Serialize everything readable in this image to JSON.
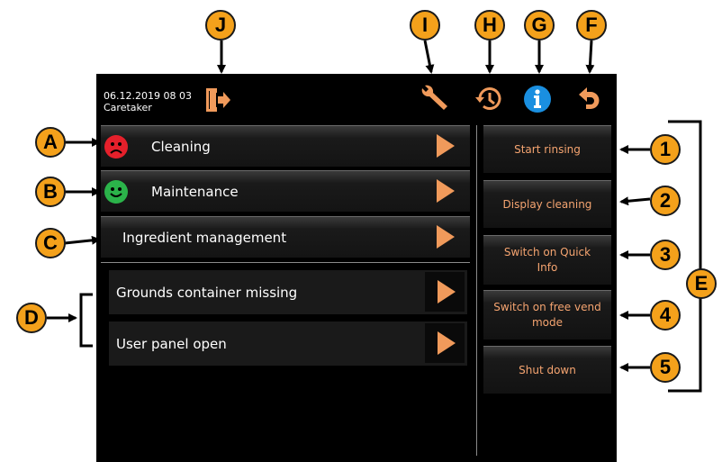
{
  "header": {
    "datetime": "06.12.2019 08 03",
    "user": "Caretaker"
  },
  "icons": {
    "exit": "exit-door-icon",
    "service": "wrench-icon",
    "history": "history-clock-icon",
    "info": "info-icon",
    "back": "back-arrow-icon"
  },
  "menu": {
    "items": [
      {
        "label": "Cleaning",
        "status": "sad-red"
      },
      {
        "label": "Maintenance",
        "status": "happy-green"
      },
      {
        "label": "Ingredient management"
      }
    ]
  },
  "messages": [
    {
      "label": "Grounds container missing"
    },
    {
      "label": "User panel open"
    }
  ],
  "actions": [
    {
      "label": "Start rinsing"
    },
    {
      "label": "Display cleaning"
    },
    {
      "label": "Switch on Quick Info"
    },
    {
      "label": "Switch on free vend mode"
    },
    {
      "label": "Shut down"
    }
  ],
  "callouts": {
    "A": "A",
    "B": "B",
    "C": "C",
    "D": "D",
    "E": "E",
    "F": "F",
    "G": "G",
    "H": "H",
    "I": "I",
    "J": "J",
    "n1": "1",
    "n2": "2",
    "n3": "3",
    "n4": "4",
    "n5": "5"
  },
  "colors": {
    "accent": "#f09a5b",
    "callout": "#f4a11b",
    "info_blue": "#1a8fe0",
    "sad_red": "#e5202b",
    "happy_green": "#2bb34a"
  }
}
